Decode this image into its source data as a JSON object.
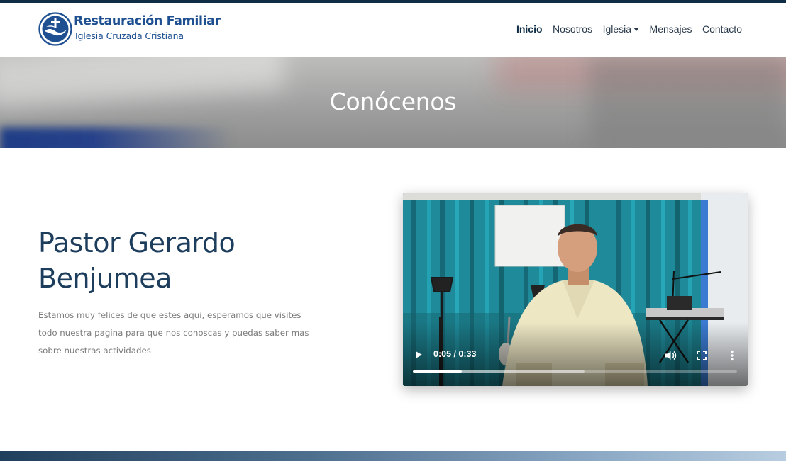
{
  "brand": {
    "title": "Restauración Familiar",
    "subtitle": "Iglesia Cruzada Cristiana",
    "logo_icon": "dove-cross-logo-icon",
    "color": "#1d4f91"
  },
  "nav": {
    "items": [
      {
        "label": "Inicio",
        "active": true
      },
      {
        "label": "Nosotros",
        "active": false
      },
      {
        "label": "Iglesia",
        "active": false,
        "dropdown": true
      },
      {
        "label": "Mensajes",
        "active": false
      },
      {
        "label": "Contacto",
        "active": false
      }
    ]
  },
  "hero": {
    "title": "Conócenos"
  },
  "about": {
    "name": "Pastor Gerardo Benjumea",
    "description": "Estamos muy felices de que estes aqui, esperamos que visites todo nuestra pagina para que nos conoscas y puedas saber mas sobre nuestras actividades"
  },
  "video": {
    "time": "0:05 / 0:33",
    "current_seconds": 5,
    "duration_seconds": 33,
    "buffered_fraction": 0.53,
    "icons": [
      "play-icon",
      "volume-icon",
      "fullscreen-icon",
      "more-options-icon"
    ]
  },
  "colors": {
    "navy": "#0f2d45",
    "heading": "#1d3d5c",
    "accent_blue": "#1d4f91"
  }
}
